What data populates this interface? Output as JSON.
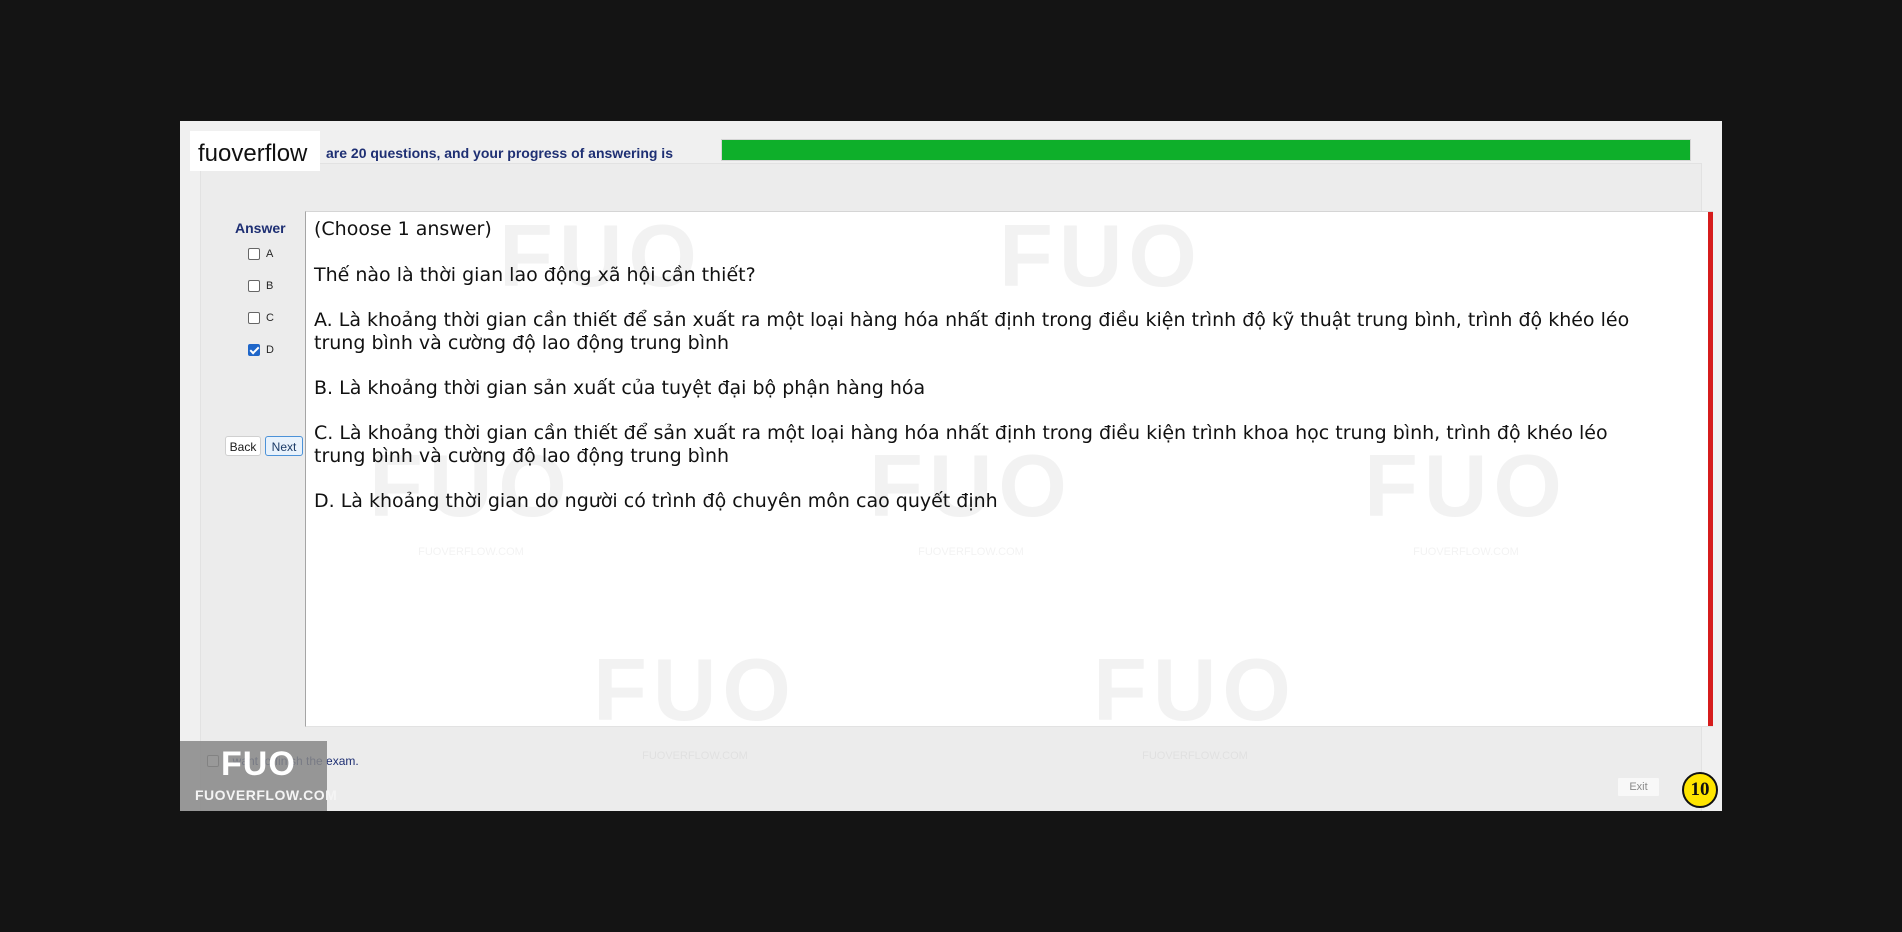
{
  "brand": {
    "label": "fuoverflow"
  },
  "progress": {
    "text": "are 20 questions, and your progress of answering is",
    "value_percent": 100,
    "color": "#0eaf2a"
  },
  "answer_panel": {
    "title": "Answer",
    "options": [
      {
        "label": "A",
        "checked": false
      },
      {
        "label": "B",
        "checked": false
      },
      {
        "label": "C",
        "checked": false
      },
      {
        "label": "D",
        "checked": true
      }
    ],
    "back_label": "Back",
    "next_label": "Next"
  },
  "question": {
    "instruction": "(Choose 1 answer)",
    "prompt": "Thế nào là thời gian lao động xã hội cần thiết?",
    "choices": [
      "A.  Là khoảng thời gian cần thiết để sản xuất ra một loại hàng hóa nhất định trong điều kiện trình độ kỹ thuật trung bình, trình độ khéo léo trung bình và cường độ lao động trung bình",
      "B.  Là khoảng thời gian sản xuất của tuyệt đại bộ phận hàng hóa",
      "C.  Là khoảng thời gian cần thiết để sản xuất ra một loại hàng hóa nhất định trong điều kiện trình khoa học trung bình, trình độ khéo léo trung bình và cường độ lao động trung bình",
      "D.  Là khoảng thời gian do người có trình độ chuyên môn cao quyết định"
    ]
  },
  "footer": {
    "finish_text": "I want to finish the exam.",
    "logo_mark": "FUO",
    "logo_text": "FUOVERFLOW.COM",
    "exit_label": "Exit",
    "timer_value": "10"
  },
  "watermark": {
    "mark": "FUO",
    "text": "FUOVERFLOW.COM"
  },
  "colors": {
    "accent_red": "#d61c1c",
    "link_blue": "#1e2f73",
    "timer_yellow": "#ffe500"
  }
}
